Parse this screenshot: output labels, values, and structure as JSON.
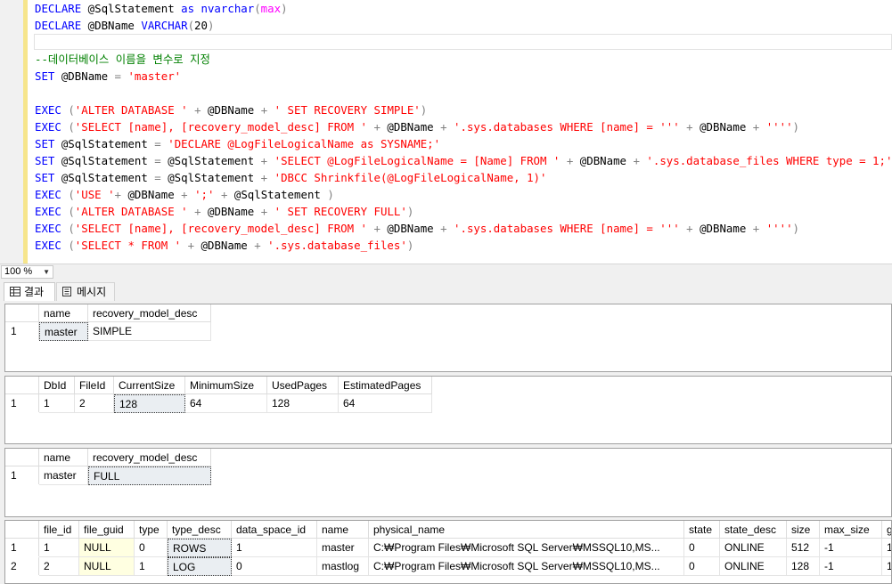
{
  "editor": {
    "lines": [
      [
        {
          "t": "DECLARE",
          "c": "kw"
        },
        {
          "t": " @SqlStatement ",
          "c": "tx"
        },
        {
          "t": "as",
          "c": "kw"
        },
        {
          "t": " ",
          "c": "tx"
        },
        {
          "t": "nvarchar",
          "c": "kw"
        },
        {
          "t": "(",
          "c": "op"
        },
        {
          "t": "max",
          "c": "fn"
        },
        {
          "t": ")",
          "c": "op"
        }
      ],
      [
        {
          "t": "DECLARE",
          "c": "kw"
        },
        {
          "t": " @DBName ",
          "c": "tx"
        },
        {
          "t": "VARCHAR",
          "c": "kw"
        },
        {
          "t": "(",
          "c": "op"
        },
        {
          "t": "20",
          "c": "tx"
        },
        {
          "t": ")",
          "c": "op"
        }
      ],
      [],
      [
        {
          "t": "--데이터베이스 이름을 변수로 지정",
          "c": "cm"
        }
      ],
      [
        {
          "t": "SET",
          "c": "kw"
        },
        {
          "t": " @DBName ",
          "c": "tx"
        },
        {
          "t": "=",
          "c": "op"
        },
        {
          "t": " ",
          "c": "tx"
        },
        {
          "t": "'master'",
          "c": "str"
        }
      ],
      [],
      [
        {
          "t": "EXEC",
          "c": "kw"
        },
        {
          "t": " ",
          "c": "tx"
        },
        {
          "t": "(",
          "c": "op"
        },
        {
          "t": "'ALTER DATABASE '",
          "c": "str"
        },
        {
          "t": " ",
          "c": "tx"
        },
        {
          "t": "+",
          "c": "op"
        },
        {
          "t": " @DBName ",
          "c": "tx"
        },
        {
          "t": "+",
          "c": "op"
        },
        {
          "t": " ",
          "c": "tx"
        },
        {
          "t": "' SET RECOVERY SIMPLE'",
          "c": "str"
        },
        {
          "t": ")",
          "c": "op"
        }
      ],
      [
        {
          "t": "EXEC",
          "c": "kw"
        },
        {
          "t": " ",
          "c": "tx"
        },
        {
          "t": "(",
          "c": "op"
        },
        {
          "t": "'SELECT [name], [recovery_model_desc] FROM '",
          "c": "str"
        },
        {
          "t": " ",
          "c": "tx"
        },
        {
          "t": "+",
          "c": "op"
        },
        {
          "t": " @DBName ",
          "c": "tx"
        },
        {
          "t": "+",
          "c": "op"
        },
        {
          "t": " ",
          "c": "tx"
        },
        {
          "t": "'.sys.databases WHERE [name] = '''",
          "c": "str"
        },
        {
          "t": " ",
          "c": "tx"
        },
        {
          "t": "+",
          "c": "op"
        },
        {
          "t": " @DBName ",
          "c": "tx"
        },
        {
          "t": "+",
          "c": "op"
        },
        {
          "t": " ",
          "c": "tx"
        },
        {
          "t": "''''",
          "c": "str"
        },
        {
          "t": ")",
          "c": "op"
        }
      ],
      [
        {
          "t": "SET",
          "c": "kw"
        },
        {
          "t": " @SqlStatement ",
          "c": "tx"
        },
        {
          "t": "=",
          "c": "op"
        },
        {
          "t": " ",
          "c": "tx"
        },
        {
          "t": "'DECLARE @LogFileLogicalName as SYSNAME;'",
          "c": "str"
        }
      ],
      [
        {
          "t": "SET",
          "c": "kw"
        },
        {
          "t": " @SqlStatement ",
          "c": "tx"
        },
        {
          "t": "=",
          "c": "op"
        },
        {
          "t": " @SqlStatement ",
          "c": "tx"
        },
        {
          "t": "+",
          "c": "op"
        },
        {
          "t": " ",
          "c": "tx"
        },
        {
          "t": "'SELECT @LogFileLogicalName = [Name] FROM '",
          "c": "str"
        },
        {
          "t": " ",
          "c": "tx"
        },
        {
          "t": "+",
          "c": "op"
        },
        {
          "t": " @DBName ",
          "c": "tx"
        },
        {
          "t": "+",
          "c": "op"
        },
        {
          "t": " ",
          "c": "tx"
        },
        {
          "t": "'.sys.database_files WHERE type = 1;'",
          "c": "str"
        }
      ],
      [
        {
          "t": "SET",
          "c": "kw"
        },
        {
          "t": " @SqlStatement ",
          "c": "tx"
        },
        {
          "t": "=",
          "c": "op"
        },
        {
          "t": " @SqlStatement ",
          "c": "tx"
        },
        {
          "t": "+",
          "c": "op"
        },
        {
          "t": " ",
          "c": "tx"
        },
        {
          "t": "'DBCC Shrinkfile(@LogFileLogicalName, 1)'",
          "c": "str"
        }
      ],
      [
        {
          "t": "EXEC",
          "c": "kw"
        },
        {
          "t": " ",
          "c": "tx"
        },
        {
          "t": "(",
          "c": "op"
        },
        {
          "t": "'USE '",
          "c": "str"
        },
        {
          "t": "+",
          "c": "op"
        },
        {
          "t": " @DBName ",
          "c": "tx"
        },
        {
          "t": "+",
          "c": "op"
        },
        {
          "t": " ",
          "c": "tx"
        },
        {
          "t": "';'",
          "c": "str"
        },
        {
          "t": " ",
          "c": "tx"
        },
        {
          "t": "+",
          "c": "op"
        },
        {
          "t": " @SqlStatement ",
          "c": "tx"
        },
        {
          "t": ")",
          "c": "op"
        }
      ],
      [
        {
          "t": "EXEC",
          "c": "kw"
        },
        {
          "t": " ",
          "c": "tx"
        },
        {
          "t": "(",
          "c": "op"
        },
        {
          "t": "'ALTER DATABASE '",
          "c": "str"
        },
        {
          "t": " ",
          "c": "tx"
        },
        {
          "t": "+",
          "c": "op"
        },
        {
          "t": " @DBName ",
          "c": "tx"
        },
        {
          "t": "+",
          "c": "op"
        },
        {
          "t": " ",
          "c": "tx"
        },
        {
          "t": "' SET RECOVERY FULL'",
          "c": "str"
        },
        {
          "t": ")",
          "c": "op"
        }
      ],
      [
        {
          "t": "EXEC",
          "c": "kw"
        },
        {
          "t": " ",
          "c": "tx"
        },
        {
          "t": "(",
          "c": "op"
        },
        {
          "t": "'SELECT [name], [recovery_model_desc] FROM '",
          "c": "str"
        },
        {
          "t": " ",
          "c": "tx"
        },
        {
          "t": "+",
          "c": "op"
        },
        {
          "t": " @DBName ",
          "c": "tx"
        },
        {
          "t": "+",
          "c": "op"
        },
        {
          "t": " ",
          "c": "tx"
        },
        {
          "t": "'.sys.databases WHERE [name] = '''",
          "c": "str"
        },
        {
          "t": " ",
          "c": "tx"
        },
        {
          "t": "+",
          "c": "op"
        },
        {
          "t": " @DBName ",
          "c": "tx"
        },
        {
          "t": "+",
          "c": "op"
        },
        {
          "t": " ",
          "c": "tx"
        },
        {
          "t": "''''",
          "c": "str"
        },
        {
          "t": ")",
          "c": "op"
        }
      ],
      [
        {
          "t": "EXEC",
          "c": "kw"
        },
        {
          "t": " ",
          "c": "tx"
        },
        {
          "t": "(",
          "c": "op"
        },
        {
          "t": "'SELECT * FROM '",
          "c": "str"
        },
        {
          "t": " ",
          "c": "tx"
        },
        {
          "t": "+",
          "c": "op"
        },
        {
          "t": " @DBName ",
          "c": "tx"
        },
        {
          "t": "+",
          "c": "op"
        },
        {
          "t": " ",
          "c": "tx"
        },
        {
          "t": "'.sys.database_files'",
          "c": "str"
        },
        {
          "t": ")",
          "c": "op"
        }
      ]
    ]
  },
  "zoom": {
    "value": "100 %"
  },
  "tabs": {
    "results": "결과",
    "messages": "메시지"
  },
  "colors": {
    "keyword": "#0000ff",
    "string": "#ff0000",
    "comment": "#008000",
    "function": "#ff00ff",
    "null_cell": "#ffffe1"
  },
  "grids": [
    {
      "columns": [
        "name",
        "recovery_model_desc"
      ],
      "rows": [
        [
          "1",
          "master",
          "SIMPLE"
        ]
      ]
    },
    {
      "columns": [
        "DbId",
        "FileId",
        "CurrentSize",
        "MinimumSize",
        "UsedPages",
        "EstimatedPages"
      ],
      "rows": [
        [
          "1",
          "1",
          "2",
          "128",
          "64",
          "128",
          "64"
        ]
      ]
    },
    {
      "columns": [
        "name",
        "recovery_model_desc"
      ],
      "rows": [
        [
          "1",
          "master",
          "FULL"
        ]
      ]
    },
    {
      "columns": [
        "file_id",
        "file_guid",
        "type",
        "type_desc",
        "data_space_id",
        "name",
        "physical_name",
        "state",
        "state_desc",
        "size",
        "max_size",
        "g"
      ],
      "rows": [
        [
          "1",
          "1",
          "NULL",
          "0",
          "ROWS",
          "1",
          "master",
          "C:₩Program Files₩Microsoft SQL Server₩MSSQL10,MS...",
          "0",
          "ONLINE",
          "512",
          "-1",
          "1"
        ],
        [
          "2",
          "2",
          "NULL",
          "1",
          "LOG",
          "0",
          "mastlog",
          "C:₩Program Files₩Microsoft SQL Server₩MSSQL10,MS...",
          "0",
          "ONLINE",
          "128",
          "-1",
          "1"
        ]
      ]
    }
  ]
}
